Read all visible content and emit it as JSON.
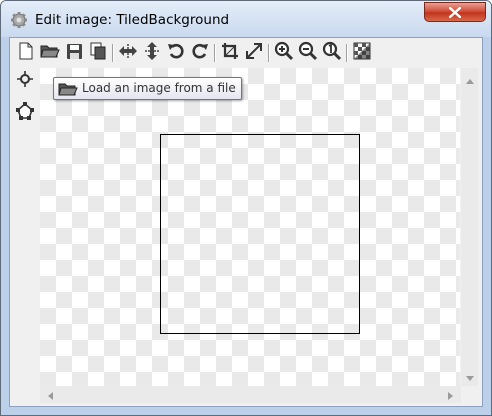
{
  "window": {
    "title": "Edit image: TiledBackground"
  },
  "toolbar": {
    "buttons": [
      {
        "name": "new-icon"
      },
      {
        "name": "open-folder-icon"
      },
      {
        "name": "save-icon"
      },
      {
        "name": "copy-icon"
      },
      {
        "name": "move-horizontal-icon"
      },
      {
        "name": "move-vertical-icon"
      },
      {
        "name": "rotate-left-icon"
      },
      {
        "name": "rotate-right-icon"
      },
      {
        "name": "crop-icon"
      },
      {
        "name": "resize-icon"
      },
      {
        "name": "zoom-in-icon"
      },
      {
        "name": "zoom-out-icon"
      },
      {
        "name": "zoom-reset-icon"
      },
      {
        "name": "transparency-icon"
      }
    ]
  },
  "side_tools": [
    {
      "name": "origin-crosshair-icon"
    },
    {
      "name": "collision-mask-icon"
    }
  ],
  "tooltip": {
    "text": "Load an image from a file",
    "icon": "open-folder-icon"
  },
  "colors": {
    "close_button": "#c2341c",
    "checker_light": "#ffffff",
    "checker_dark": "#e9e9e9",
    "image_border": "#000000"
  }
}
